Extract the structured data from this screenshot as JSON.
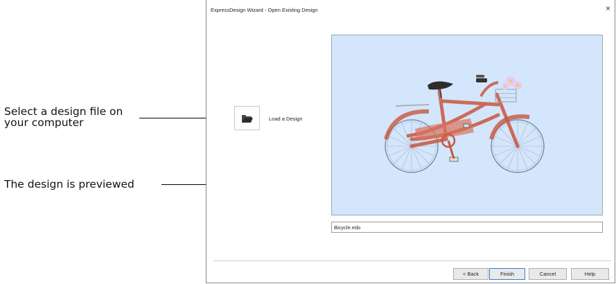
{
  "callouts": {
    "load": "Select a design file on your computer",
    "preview": "The design is previewed"
  },
  "dialog": {
    "title": "ExpressDesign Wizard - Open Existing Design",
    "close": "×",
    "load_label": "Load a Design",
    "filename": "Bicycle.edo",
    "buttons": {
      "back": "< Back",
      "finish": "Finish",
      "cancel": "Cancel",
      "help": "Help"
    }
  },
  "icons": {
    "load": "folder-open-icon",
    "close": "close-icon"
  },
  "colors": {
    "preview_bg": "#d3e6fb",
    "bike": "#c9563f",
    "focus_border": "#2f7fd8"
  }
}
